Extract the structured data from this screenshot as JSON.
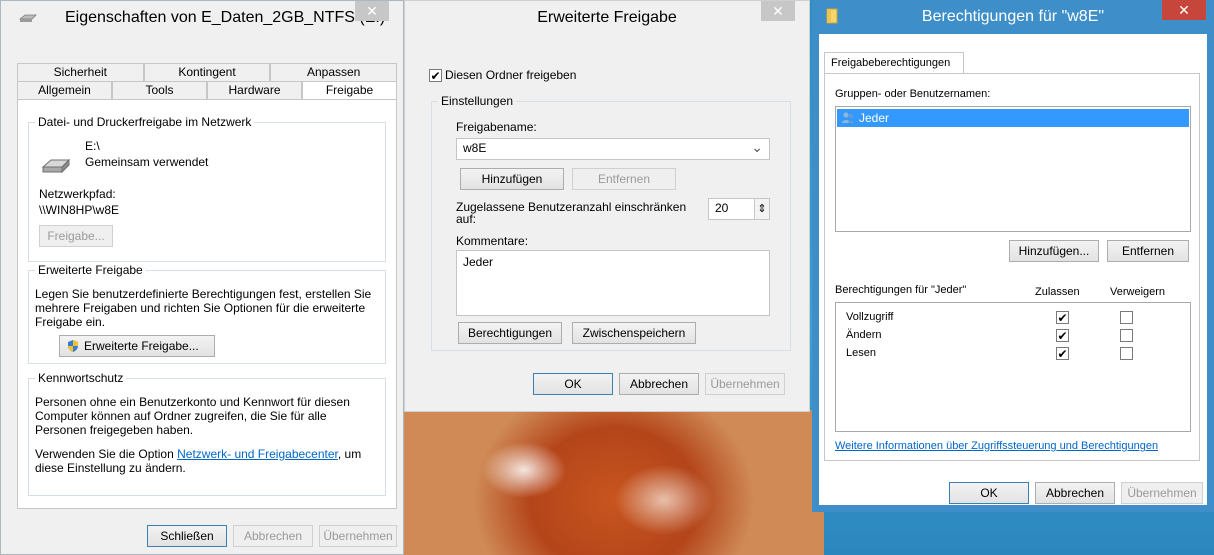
{
  "win1": {
    "title": "Eigenschaften von E_Daten_2GB_NTFS (E:)",
    "tabs_row1": [
      "Sicherheit",
      "Kontingent",
      "Anpassen"
    ],
    "tabs_row2": [
      "Allgemein",
      "Tools",
      "Hardware",
      "Freigabe"
    ],
    "group_network": "Datei- und Druckerfreigabe im Netzwerk",
    "drive_path": "E:\\",
    "drive_status": "Gemeinsam verwendet",
    "netpath_label": "Netzwerkpfad:",
    "netpath_value": "\\\\WIN8HP\\w8E",
    "freigabe_btn": "Freigabe...",
    "group_advanced": "Erweiterte Freigabe",
    "advanced_desc1": "Legen Sie benutzerdefinierte Berechtigungen fest, erstellen Sie",
    "advanced_desc2": "mehrere Freigaben und richten Sie Optionen für die erweiterte",
    "advanced_desc3": "Freigabe ein.",
    "advanced_btn": "Erweiterte Freigabe...",
    "group_password": "Kennwortschutz",
    "pw_desc1": "Personen ohne ein Benutzerkonto und Kennwort für diesen",
    "pw_desc2": "Computer können auf Ordner zugreifen, die Sie für alle",
    "pw_desc3": "Personen freigegeben haben.",
    "pw_use_prefix": "Verwenden Sie die Option ",
    "pw_use_link": "Netzwerk- und Freigabecenter",
    "pw_use_suffix": ", um",
    "pw_use_line2": "diese Einstellung zu ändern.",
    "close_btn": "Schließen",
    "cancel_btn": "Abbrechen",
    "apply_btn": "Übernehmen"
  },
  "win2": {
    "title": "Erweiterte Freigabe",
    "share_checkbox": "Diesen Ordner freigeben",
    "settings_label": "Einstellungen",
    "sharename_label": "Freigabename:",
    "sharename_value": "w8E",
    "add_btn": "Hinzufügen",
    "remove_btn": "Entfernen",
    "limit_label1": "Zugelassene Benutzeranzahl einschränken",
    "limit_label2": "auf:",
    "limit_value": "20",
    "comments_label": "Kommentare:",
    "comments_value": "Jeder",
    "permissions_btn": "Berechtigungen",
    "cache_btn": "Zwischenspeichern",
    "ok_btn": "OK",
    "cancel_btn": "Abbrechen",
    "apply_btn": "Übernehmen"
  },
  "win3": {
    "title": "Berechtigungen für \"w8E\"",
    "tab": "Freigabeberechtigungen",
    "groups_label": "Gruppen- oder Benutzernamen:",
    "selected_user": "Jeder",
    "add_btn": "Hinzufügen...",
    "remove_btn": "Entfernen",
    "perm_label": "Berechtigungen für \"Jeder\"",
    "allow_header": "Zulassen",
    "deny_header": "Verweigern",
    "permissions": [
      {
        "name": "Vollzugriff",
        "allow": true,
        "deny": false
      },
      {
        "name": "Ändern",
        "allow": true,
        "deny": false
      },
      {
        "name": "Lesen",
        "allow": true,
        "deny": false
      }
    ],
    "info_link": "Weitere Informationen über Zugriffssteuerung und Berechtigungen",
    "ok_btn": "OK",
    "cancel_btn": "Abbrechen",
    "apply_btn": "Übernehmen"
  },
  "close_glyph": "✕",
  "check_glyph": "✔",
  "spinner_glyph": "⇕",
  "dropdown_glyph": "⌄"
}
